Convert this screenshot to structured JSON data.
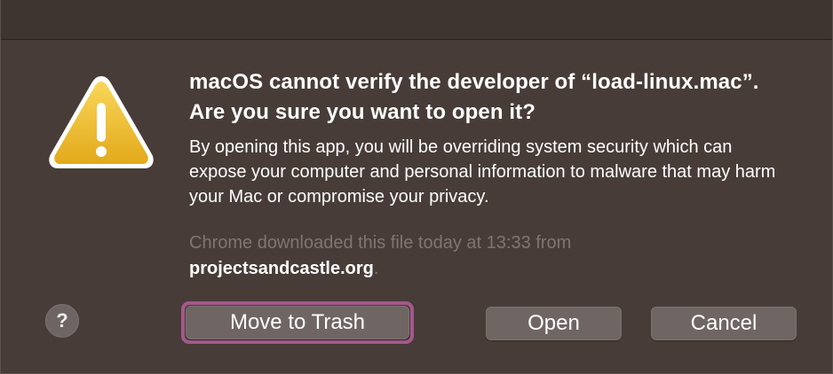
{
  "dialog": {
    "title": "macOS cannot verify the developer of “load-linux.mac”. Are you sure you want to open it?",
    "message": "By opening this app, you will be overriding system security which can expose your computer and personal information to malware that may harm your Mac or compromise your privacy.",
    "source_prefix": "Chrome downloaded this file today at 13:33 from",
    "source_domain": "projectsandcastle.org",
    "source_suffix": ".",
    "icon": "warning-icon"
  },
  "buttons": {
    "help_label": "?",
    "move_to_trash_label": "Move to Trash",
    "open_label": "Open",
    "cancel_label": "Cancel",
    "focused": "Move to Trash"
  },
  "colors": {
    "dialog_background": "#473c38",
    "button_background": "#6f6663",
    "focus_ring": "#a4588c",
    "warning_yellow": "#f2c12e",
    "muted_text": "#7f7672"
  }
}
